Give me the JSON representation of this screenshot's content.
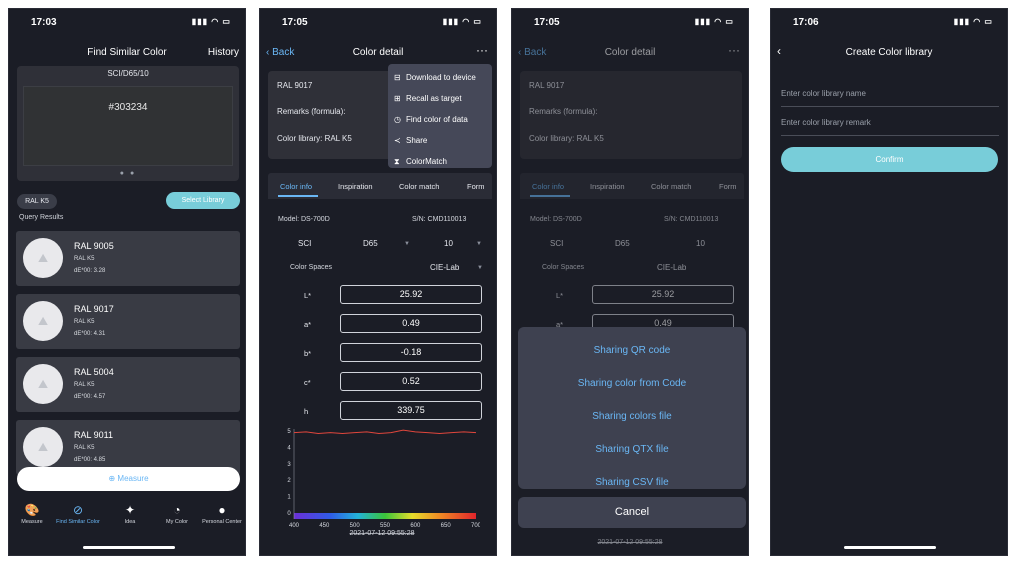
{
  "screen1": {
    "time": "17:03",
    "title": "Find Similar Color",
    "history": "History",
    "mode": "SCI/D65/10",
    "hex": "#303234",
    "swatch_color": "#303234",
    "library_chip": "RAL K5",
    "select_library": "Select Library",
    "query_results_label": "Query Results",
    "results": [
      {
        "name": "RAL 9005",
        "library": "RAL K5",
        "de": "dE*00: 3.28"
      },
      {
        "name": "RAL 9017",
        "library": "RAL K5",
        "de": "dE*00: 4.31"
      },
      {
        "name": "RAL 5004",
        "library": "RAL K5",
        "de": "dE*00: 4.57"
      },
      {
        "name": "RAL 9011",
        "library": "RAL K5",
        "de": "dE*00: 4.85"
      }
    ],
    "measure": "Measure",
    "tabs": [
      {
        "label": "Measure",
        "icon": "palette-icon"
      },
      {
        "label": "Find Similar Color",
        "icon": "compass-icon"
      },
      {
        "label": "Idea",
        "icon": "lightbulb-icon"
      },
      {
        "label": "My Color",
        "icon": "pie-chart-icon"
      },
      {
        "label": "Personal Center",
        "icon": "user-icon"
      }
    ]
  },
  "screen2": {
    "time": "17:05",
    "back": "Back",
    "title": "Color detail",
    "color_name": "RAL 9017",
    "remarks": "Remarks (formula):",
    "library": "Color library: RAL K5",
    "menu": [
      "Download to device",
      "Recall as target",
      "Find color of data",
      "Share",
      "ColorMatch"
    ],
    "tabs": [
      "Color info",
      "Inspiration",
      "Color match",
      "Form"
    ],
    "model": "Model:  DS-700D",
    "sn": "S/N:  CMD110013",
    "mode": "SCI",
    "illuminant": "D65",
    "observer": "10",
    "color_spaces_label": "Color Spaces",
    "color_space": "CIE-Lab",
    "fields": [
      {
        "label": "L*",
        "value": "25.92"
      },
      {
        "label": "a*",
        "value": "0.49"
      },
      {
        "label": "b*",
        "value": "-0.18"
      },
      {
        "label": "c*",
        "value": "0.52"
      },
      {
        "label": "h",
        "value": "339.75"
      }
    ],
    "timestamp": "2021-07-12 09:55:28"
  },
  "screen3": {
    "time": "17:05",
    "back": "Back",
    "title": "Color detail",
    "color_name": "RAL 9017",
    "remarks": "Remarks (formula):",
    "library": "Color library: RAL K5",
    "tabs": [
      "Color info",
      "Inspiration",
      "Color match",
      "Form"
    ],
    "model": "Model:  DS-700D",
    "sn": "S/N:  CMD110013",
    "mode": "SCI",
    "illuminant": "D65",
    "observer": "10",
    "color_spaces_label": "Color Spaces",
    "color_space": "CIE-Lab",
    "fields": [
      {
        "label": "L*",
        "value": "25.92"
      },
      {
        "label": "a*",
        "value": "0.49"
      }
    ],
    "share_options": [
      "Sharing QR code",
      "Sharing color from Code",
      "Sharing colors file",
      "Sharing QTX file",
      "Sharing CSV file"
    ],
    "cancel": "Cancel",
    "timestamp": "2021-07-12 09:55:28"
  },
  "screen4": {
    "time": "17:06",
    "title": "Create Color library",
    "name_placeholder": "Enter color library name",
    "remark_placeholder": "Enter color library remark",
    "confirm": "Confirm"
  },
  "chart_data": {
    "type": "line",
    "x": [
      400,
      420,
      440,
      460,
      480,
      500,
      520,
      540,
      560,
      580,
      600,
      620,
      640,
      660,
      680,
      700
    ],
    "series": [
      {
        "values": [
          4.9,
          4.95,
          4.85,
          4.9,
          4.85,
          4.9,
          4.95,
          4.85,
          4.9,
          5.05,
          4.95,
          4.9,
          4.85,
          4.9,
          4.95,
          4.9
        ]
      }
    ],
    "xlim": [
      400,
      700
    ],
    "ylim": [
      0,
      5
    ],
    "xticks": [
      "400",
      "450",
      "500",
      "550",
      "600",
      "650",
      "700"
    ],
    "yticks": [
      "0",
      "1",
      "2",
      "3",
      "4",
      "5"
    ],
    "line_color": "#e0463c"
  }
}
